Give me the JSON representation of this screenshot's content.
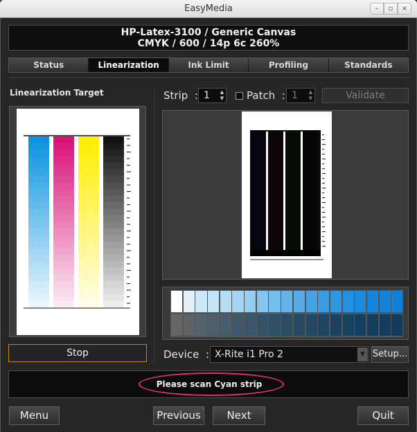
{
  "window": {
    "title": "EasyMedia",
    "buttons": [
      "–",
      "▫",
      "×"
    ]
  },
  "header": {
    "line1": "HP-Latex-3100 / Generic Canvas",
    "line2": "CMYK / 600 / 14p 6c 260%"
  },
  "tabs": [
    {
      "label": "Status",
      "active": false
    },
    {
      "label": "Linearization",
      "active": true
    },
    {
      "label": "Ink Limit",
      "active": false
    },
    {
      "label": "Profiling",
      "active": false
    },
    {
      "label": "Standards",
      "active": false
    }
  ],
  "left_panel": {
    "title": "Linearization Target",
    "columns": [
      {
        "name": "cyan",
        "start": "#0a93df",
        "end": "#eaf6fd"
      },
      {
        "name": "magenta",
        "start": "#d9137a",
        "end": "#fbeaf2"
      },
      {
        "name": "yellow",
        "start": "#ffee00",
        "end": "#fffce8"
      },
      {
        "name": "black",
        "start": "#121212",
        "end": "#eeeeee"
      }
    ],
    "stop_label": "Stop"
  },
  "strip_controls": {
    "strip_label": "Strip",
    "strip_value": "1",
    "patch_label": "Patch",
    "patch_value": "1",
    "patch_checked": false,
    "validate_label": "Validate",
    "separator": ":"
  },
  "palette": {
    "top_row": [
      "#ffffff",
      "#e3f1fb",
      "#cfe8f8",
      "#c3e3f7",
      "#b5dcf5",
      "#a6d5f3",
      "#96cdf1",
      "#86c5ef",
      "#75bdec",
      "#64b4ea",
      "#54abe7",
      "#45a3e5",
      "#3a9ce3",
      "#2f96e2",
      "#248fe0",
      "#1c8add",
      "#1585db",
      "#1382da",
      "#107fd8"
    ],
    "bottom_row": [
      "#656565",
      "#5e6368",
      "#56626c",
      "#4e606d",
      "#475d6b",
      "#41596a",
      "#3a5668",
      "#345366",
      "#2f5065",
      "#2a4d64",
      "#264a63",
      "#224862",
      "#1e4561",
      "#1b4360",
      "#18415f",
      "#153f5e",
      "#133e5d",
      "#113c5c",
      "#103b5c"
    ]
  },
  "device": {
    "label": "Device",
    "value": "X-Rite i1 Pro 2",
    "setup_label": "Setup...",
    "separator": ":"
  },
  "status": {
    "message": "Please scan Cyan strip",
    "highlight_color": "#e0327a"
  },
  "bottom_bar": {
    "menu": "Menu",
    "previous": "Previous",
    "next": "Next",
    "quit": "Quit"
  }
}
